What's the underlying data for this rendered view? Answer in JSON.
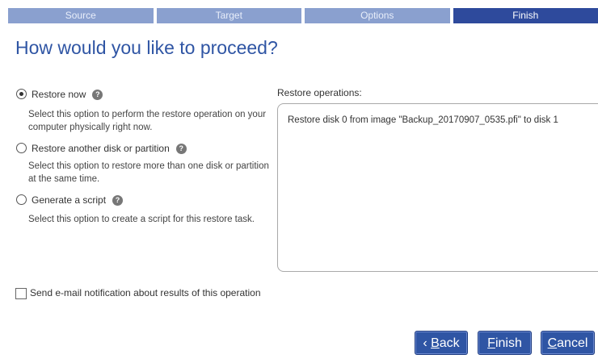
{
  "steps": [
    "Source",
    "Target",
    "Options",
    "Finish"
  ],
  "title": "How would you like to proceed?",
  "options": [
    {
      "label": "Restore now",
      "desc": "Select this option to perform the restore operation on your computer physically right now.",
      "checked": true
    },
    {
      "label": "Restore another disk or partition",
      "desc": "Select this option to restore more than one disk or partition at the same time.",
      "checked": false
    },
    {
      "label": "Generate a script",
      "desc": "Select this option to create a script for this restore task.",
      "checked": false
    }
  ],
  "help_glyph": "?",
  "ops": {
    "label": "Restore operations:",
    "items": [
      "Restore disk 0 from image \"Backup_20170907_0535.pfi\" to disk 1"
    ]
  },
  "email_notification": {
    "label": "Send e-mail notification about results of this operation",
    "checked": false
  },
  "buttons": {
    "back_prefix": "‹ ",
    "back_mnemonic": "B",
    "back_rest": "ack",
    "finish_mnemonic": "F",
    "finish_rest": "inish",
    "cancel_mnemonic": "C",
    "cancel_rest": "ancel"
  },
  "colors": {
    "accent": "#2f55a4",
    "step_inactive": "#8aa0cf",
    "step_active": "#2e4a9c"
  }
}
